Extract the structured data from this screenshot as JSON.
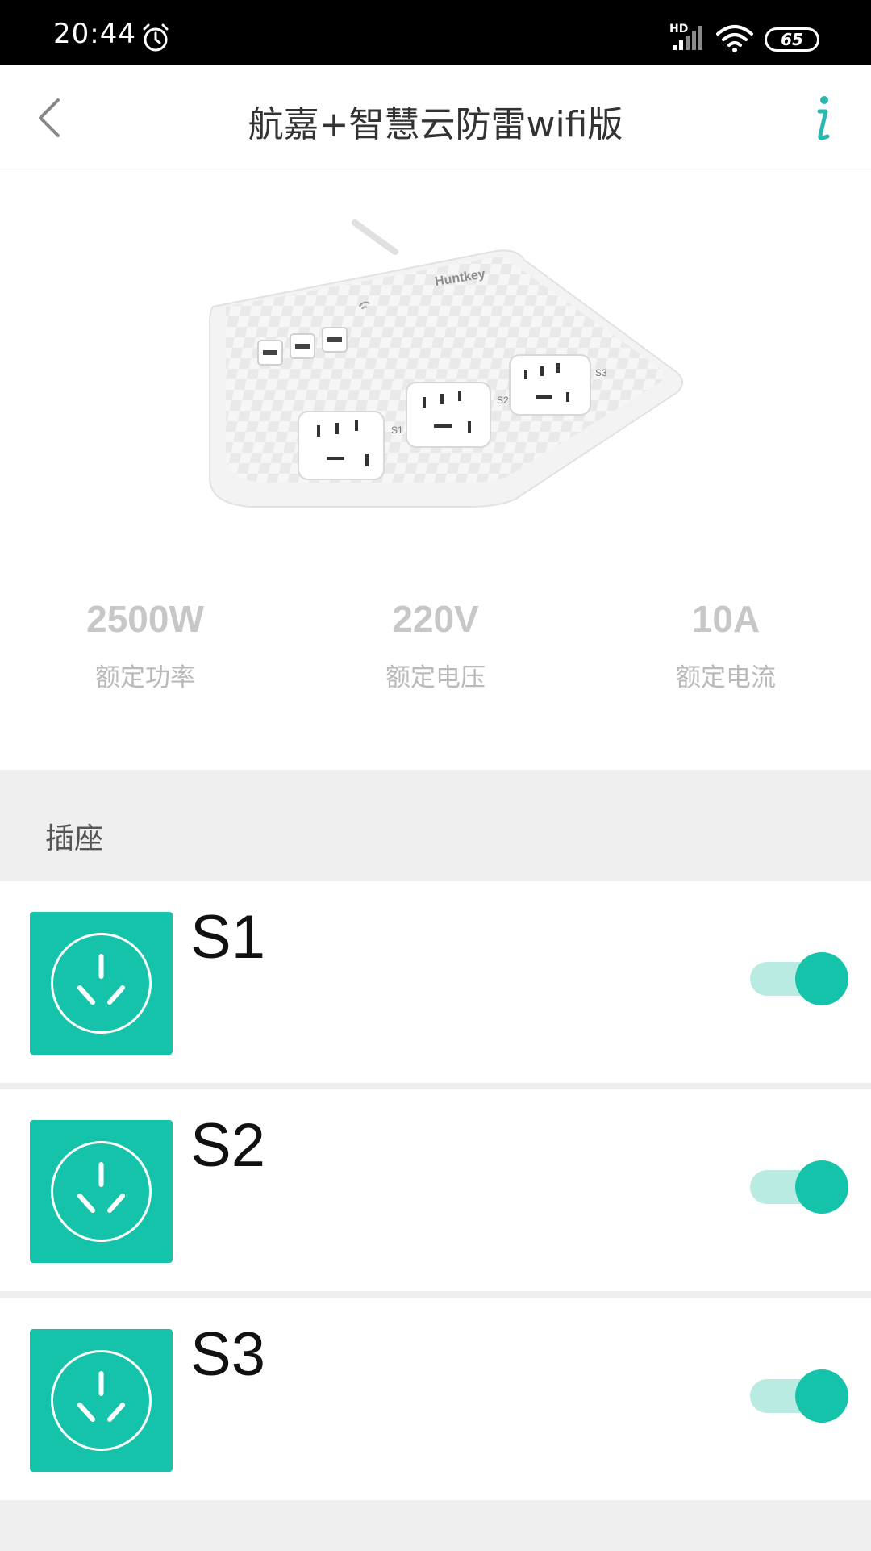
{
  "status": {
    "time": "20:44",
    "network": "HD",
    "battery": "65"
  },
  "header": {
    "title": "航嘉+智慧云防雷wifi版"
  },
  "product": {
    "brand": "Huntkey",
    "socket_labels": [
      "S1",
      "S2",
      "S3"
    ]
  },
  "specs": [
    {
      "value": "2500W",
      "label": "额定功率"
    },
    {
      "value": "220V",
      "label": "额定电压"
    },
    {
      "value": "10A",
      "label": "额定电流"
    }
  ],
  "section": {
    "label": "插座"
  },
  "sockets": [
    {
      "name": "S1",
      "on": true
    },
    {
      "name": "S2",
      "on": true
    },
    {
      "name": "S3",
      "on": true
    }
  ],
  "colors": {
    "accent": "#14c3aa",
    "accent_light": "#b9ebe2",
    "info_icon": "#2bb7b0"
  }
}
